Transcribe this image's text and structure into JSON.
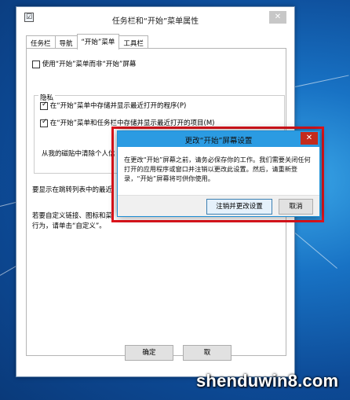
{
  "window": {
    "title": "任务栏和“开始”菜单属性",
    "close_glyph": "✕",
    "app_icon_glyph": "☑"
  },
  "tabs": [
    {
      "label": "任务栏",
      "active": false
    },
    {
      "label": "导航",
      "active": false
    },
    {
      "label": "“开始”菜单",
      "active": true
    },
    {
      "label": "工具栏",
      "active": false
    }
  ],
  "panel": {
    "use_start_menu": {
      "label": "使用“开始”菜单而非“开始”屏幕",
      "checked": false
    },
    "privacy_group_title": "隐私",
    "privacy_items": [
      {
        "label": "在“开始”菜单中存储并显示最近打开的程序(P)",
        "checked": true
      },
      {
        "label": "在“开始”菜单和任务栏中存储并显示最近打开的项目(M)",
        "checked": true
      }
    ],
    "clear_text": "从我的磁贴中清除个人信",
    "jumplist_text": "要显示在跳转列表中的最近",
    "customize_text_line1": "若要自定义链接、图标和菜",
    "customize_text_line2": "行为，请单击“自定义”。"
  },
  "footer_buttons": {
    "ok": "确定",
    "cancel": "取"
  },
  "dialog": {
    "title": "更改“开始”屏幕设置",
    "close_glyph": "✕",
    "message": "在更改“开始”屏幕之前，请务必保存你的工作。我们需要关闭任何打开的应用程序或窗口并注销以更改此设置。然后，请重新登录，“开始”屏幕将可供你使用。",
    "primary_button": "注销并更改设置",
    "cancel_button": "取消"
  },
  "watermark": "shenduwin8.com",
  "colors": {
    "dialog_titlebar": "#2b9be2",
    "highlight_border": "#e0141c",
    "close_red": "#c42b1c",
    "desktop_blue": "#1872c4"
  }
}
